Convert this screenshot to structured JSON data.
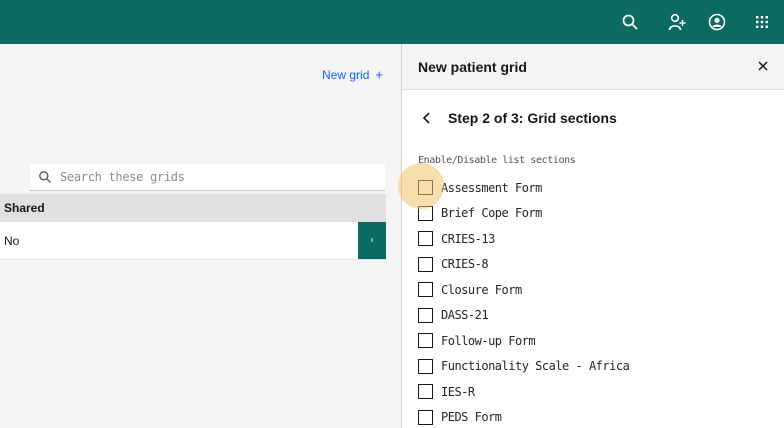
{
  "topbar": {
    "icons": [
      "search-icon",
      "add-user-icon",
      "user-avatar-icon",
      "app-switcher-icon"
    ]
  },
  "left": {
    "new_grid_label": "New grid",
    "new_grid_icon": "+",
    "search_placeholder": "Search these grids",
    "table": {
      "header": "Shared",
      "rows": [
        {
          "shared": "No"
        }
      ]
    }
  },
  "panel": {
    "title": "New patient grid",
    "close_label": "×",
    "step_label": "Step 2 of 3: Grid sections",
    "section_label": "Enable/Disable list sections",
    "sections": [
      {
        "label": "Assessment Form",
        "checked": false
      },
      {
        "label": "Brief Cope Form",
        "checked": false
      },
      {
        "label": "CRIES-13",
        "checked": false
      },
      {
        "label": "CRIES-8",
        "checked": false
      },
      {
        "label": "Closure Form",
        "checked": false
      },
      {
        "label": "DASS-21",
        "checked": false
      },
      {
        "label": "Follow-up Form",
        "checked": false
      },
      {
        "label": "Functionality Scale - Africa",
        "checked": false
      },
      {
        "label": "IES-R",
        "checked": false
      },
      {
        "label": "PEDS Form",
        "checked": false
      }
    ]
  },
  "colors": {
    "brand_teal": "#0b6b61",
    "link_blue": "#0f62fe",
    "cursor_highlight": "#f1c26e"
  }
}
